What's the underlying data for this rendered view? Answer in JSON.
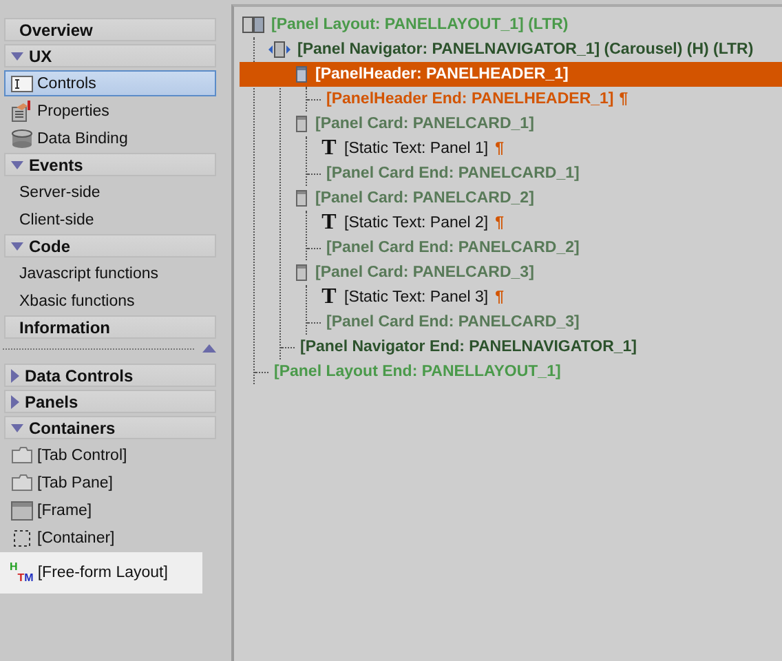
{
  "sidebar": {
    "upper": [
      {
        "title": "Overview"
      },
      {
        "title": "UX",
        "expanded": true,
        "items": [
          {
            "label": "Controls",
            "kind": "controls",
            "selected": true,
            "hovered": false
          },
          {
            "label": "Properties",
            "kind": "properties",
            "selected": false,
            "hovered": false
          },
          {
            "label": "Data Binding",
            "kind": "database",
            "selected": false,
            "hovered": false
          }
        ]
      },
      {
        "title": "Events",
        "expanded": true,
        "items": [
          {
            "label": "Server-side",
            "kind": "plain",
            "selected": false,
            "hovered": false
          },
          {
            "label": "Client-side",
            "kind": "plain",
            "selected": false,
            "hovered": false
          }
        ]
      },
      {
        "title": "Code",
        "expanded": true,
        "items": [
          {
            "label": "Javascript functions",
            "kind": "plain",
            "selected": false,
            "hovered": false
          },
          {
            "label": "Xbasic functions",
            "kind": "plain",
            "selected": false,
            "hovered": false
          }
        ]
      },
      {
        "title": "Information"
      }
    ],
    "lower": [
      {
        "title": "Data Controls",
        "expanded": false
      },
      {
        "title": "Panels",
        "expanded": false
      },
      {
        "title": "Containers",
        "expanded": true,
        "items": [
          {
            "label": "[Tab Control]",
            "kind": "folder",
            "selected": false,
            "hovered": false
          },
          {
            "label": "[Tab Pane]",
            "kind": "folder",
            "selected": false,
            "hovered": false
          },
          {
            "label": "[Frame]",
            "kind": "frame",
            "selected": false,
            "hovered": false
          },
          {
            "label": "[Container]",
            "kind": "container",
            "selected": false,
            "hovered": false
          },
          {
            "label": "[Free-form Layout]",
            "kind": "htm",
            "icon_letters": "HTM",
            "selected": false,
            "hovered": true
          }
        ]
      }
    ]
  },
  "tree": [
    {
      "label": "[Panel Layout: PANELLAYOUT_1] (LTR)",
      "kind": "layout",
      "selected": false,
      "children": [
        {
          "label": "[Panel Navigator: PANELNAVIGATOR_1] (Carousel)  (H) (LTR)",
          "kind": "navigator",
          "selected": false,
          "children": [
            {
              "label": "[PanelHeader: PANELHEADER_1]",
              "kind": "header",
              "selected": true,
              "children": [
                {
                  "label": "[PanelHeader End: PANELHEADER_1]",
                  "kind": "header-end",
                  "suffix": "¶",
                  "selected": false
                }
              ]
            },
            {
              "label": "[Panel Card: PANELCARD_1]",
              "kind": "card",
              "selected": false,
              "children": [
                {
                  "label": "[Static Text: Panel 1]",
                  "kind": "text",
                  "glyph": "T",
                  "suffix": "¶",
                  "selected": false
                },
                {
                  "label": "[Panel Card End: PANELCARD_1]",
                  "kind": "card-end",
                  "selected": false
                }
              ]
            },
            {
              "label": "[Panel Card: PANELCARD_2]",
              "kind": "card",
              "selected": false,
              "children": [
                {
                  "label": "[Static Text: Panel 2]",
                  "kind": "text",
                  "glyph": "T",
                  "suffix": "¶",
                  "selected": false
                },
                {
                  "label": "[Panel Card End: PANELCARD_2]",
                  "kind": "card-end",
                  "selected": false
                }
              ]
            },
            {
              "label": "[Panel Card: PANELCARD_3]",
              "kind": "card",
              "selected": false,
              "children": [
                {
                  "label": "[Static Text: Panel 3]",
                  "kind": "text",
                  "glyph": "T",
                  "suffix": "¶",
                  "selected": false
                },
                {
                  "label": "[Panel Card End: PANELCARD_3]",
                  "kind": "card-end",
                  "selected": false
                }
              ]
            },
            {
              "label": "[Panel Navigator End: PANELNAVIGATOR_1]",
              "kind": "navigator-end",
              "selected": false
            }
          ]
        },
        {
          "label": "[Panel Layout End: PANELLAYOUT_1]",
          "kind": "layout-end",
          "selected": false
        }
      ]
    }
  ]
}
